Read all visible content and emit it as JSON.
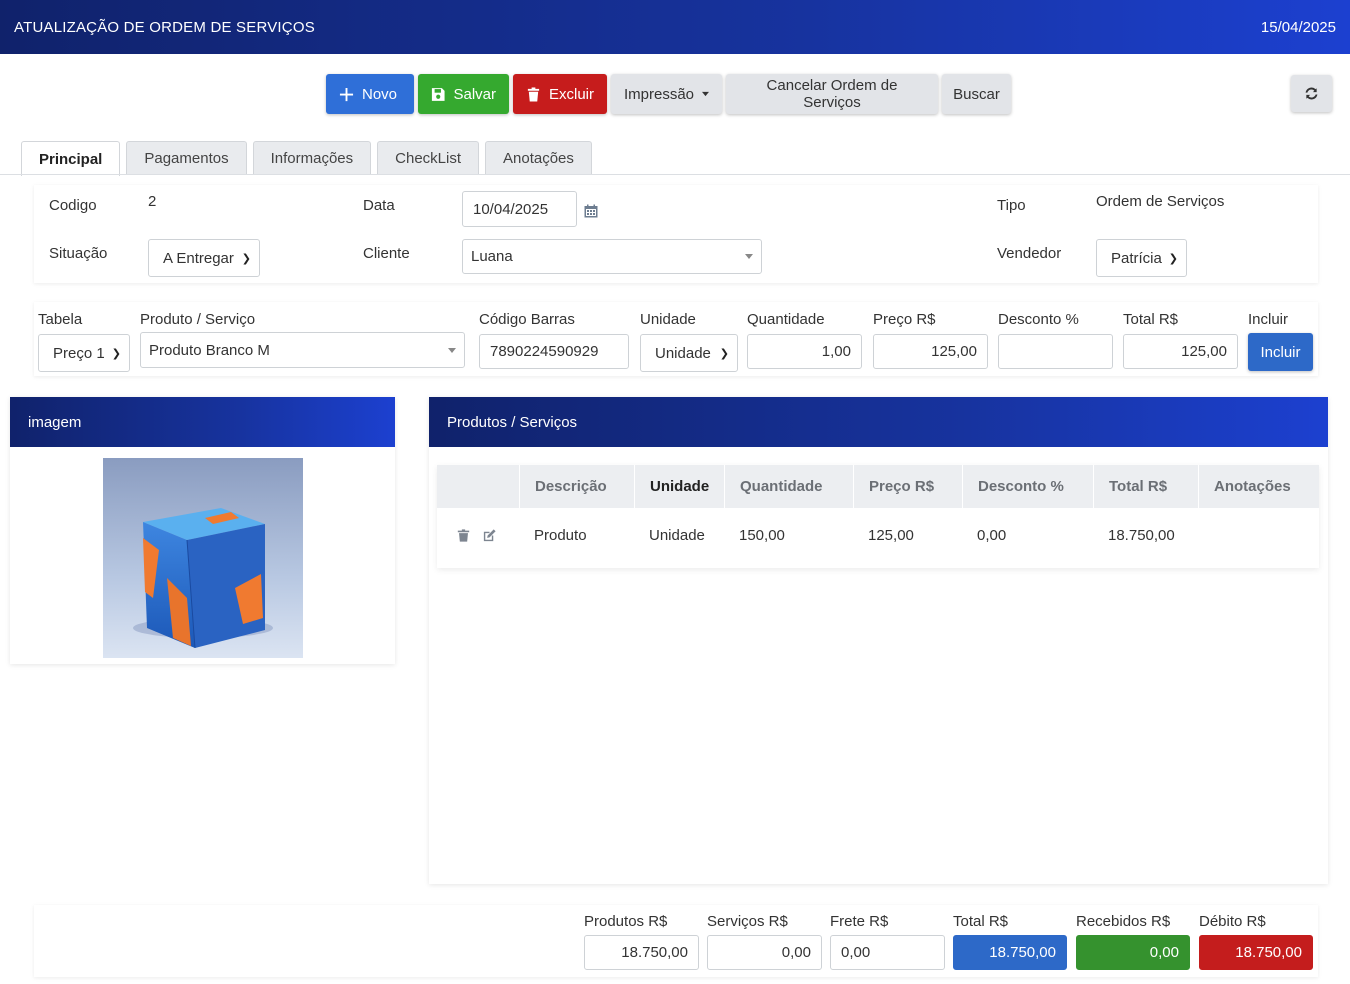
{
  "header": {
    "title": "ATUALIZAÇÃO DE ORDEM DE SERVIÇOS",
    "date": "15/04/2025"
  },
  "toolbar": {
    "novo": "Novo",
    "salvar": "Salvar",
    "excluir": "Excluir",
    "impressao": "Impressão",
    "cancelar": "Cancelar Ordem de Serviços",
    "buscar": "Buscar"
  },
  "tabs": [
    {
      "label": "Principal",
      "active": true
    },
    {
      "label": "Pagamentos"
    },
    {
      "label": "Informações"
    },
    {
      "label": "CheckList"
    },
    {
      "label": "Anotações"
    }
  ],
  "principal": {
    "codigo_label": "Codigo",
    "codigo": "2",
    "data_label": "Data",
    "data": "10/04/2025",
    "tipo_label": "Tipo",
    "tipo": "Ordem de Serviços",
    "situacao_label": "Situação",
    "situacao": "A Entregar",
    "cliente_label": "Cliente",
    "cliente": "Luana",
    "vendedor_label": "Vendedor",
    "vendedor": "Patrícia"
  },
  "item_entry": {
    "tabela_label": "Tabela",
    "tabela": "Preço 1",
    "produto_label": "Produto / Serviço",
    "produto": "Produto Branco M",
    "barras_label": "Código Barras",
    "barras": "7890224590929",
    "unidade_label": "Unidade",
    "unidade": "Unidade",
    "quantidade_label": "Quantidade",
    "quantidade": "1,00",
    "preco_label": "Preço R$",
    "preco": "125,00",
    "desconto_label": "Desconto %",
    "desconto": "",
    "total_label": "Total R$",
    "total": "125,00",
    "incluir_label": "Incluir",
    "incluir_button": "Incluir"
  },
  "image_panel": {
    "title": "imagem"
  },
  "products_panel": {
    "title": "Produtos / Serviços",
    "columns": [
      "Descrição",
      "Unidade",
      "Quantidade",
      "Preço R$",
      "Desconto %",
      "Total R$",
      "Anotações"
    ],
    "rows": [
      {
        "descricao": "Produto",
        "unidade": "Unidade",
        "quantidade": "150,00",
        "preco": "125,00",
        "desconto": "0,00",
        "total": "18.750,00",
        "anotacoes": ""
      }
    ]
  },
  "totals": {
    "produtos_label": "Produtos R$",
    "produtos": "18.750,00",
    "servicos_label": "Serviços R$",
    "servicos": "0,00",
    "frete_label": "Frete R$",
    "frete": "0,00",
    "total_label": "Total R$",
    "total": "18.750,00",
    "recebidos_label": "Recebidos R$",
    "recebidos": "0,00",
    "debito_label": "Débito R$",
    "debito": "18.750,00"
  },
  "colors": {
    "header_dark": "#10226b",
    "header_light": "#1c40d0",
    "primary": "#2f6fd8",
    "success": "#35a92f",
    "danger": "#c61c1c"
  },
  "icons": [
    "plus-icon",
    "save-icon",
    "trash-icon",
    "caret-down-icon",
    "refresh-icon",
    "calendar-icon",
    "edit-icon"
  ]
}
